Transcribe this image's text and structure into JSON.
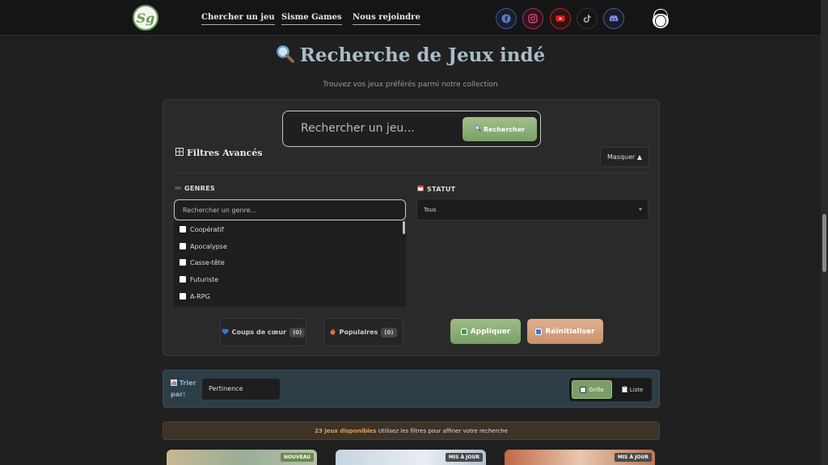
{
  "nav": {
    "logo_text": "Sg",
    "links": [
      "Chercher un jeu",
      "Sisme Games",
      "Nous rejoindre"
    ],
    "social_icons": [
      "facebook-icon",
      "instagram-icon",
      "youtube-icon",
      "tiktok-icon",
      "discord-icon"
    ]
  },
  "header": {
    "title": "Recherche de Jeux indé",
    "subtitle": "Trouvez vos jeux préférés parmi notre collection"
  },
  "search": {
    "placeholder": "Rechercher un jeu...",
    "button_label": "Rechercher"
  },
  "filters": {
    "title": "Filtres Avancés",
    "hide_label": "Masquer ▲",
    "genres": {
      "label": "GENRES",
      "placeholder": "Rechercher un genre...",
      "items": [
        "Coopératif",
        "Apocalypse",
        "Casse-tête",
        "Futuriste",
        "A-RPG"
      ]
    },
    "status": {
      "label": "STATUT",
      "selected": "Tous"
    },
    "favorites": {
      "label": "Coups de cœur",
      "count": "(0)"
    },
    "popular": {
      "label": "Populaires",
      "count": "(0)"
    },
    "apply_label": "Appliquer",
    "reset_label": "Réinitialiser"
  },
  "sort": {
    "label": "Trier par:",
    "selected": "Pertinence",
    "view_grid": "Grille",
    "view_list": "Liste"
  },
  "results": {
    "count_text": "23 jeux disponibles",
    "hint": "Utilisez les filtres pour affiner votre recherche"
  },
  "cards": [
    {
      "badge": "NOUVEAU"
    },
    {
      "badge": "MIS À JOUR"
    },
    {
      "badge": "MIS À JOUR"
    }
  ],
  "colors": {
    "accent_green": "#7aa068",
    "accent_orange": "#c8926a",
    "title_blue": "#a8bcc6"
  }
}
